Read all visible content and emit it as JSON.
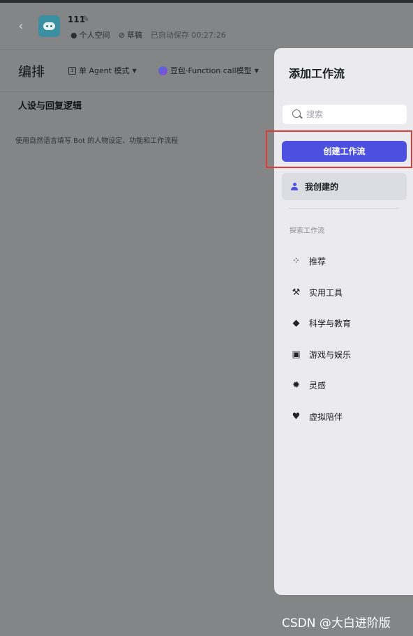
{
  "header": {
    "bot_name": "111",
    "space": "个人空间",
    "status": "草稿",
    "autosave": "已自动保存 00:27:26"
  },
  "toolbar": {
    "title": "编排",
    "mode": "单 Agent 模式",
    "model": "豆包·Function call模型"
  },
  "prompt": {
    "section_title": "人设与回复逻辑",
    "hint": "使用自然语言填写 Bot 的人物设定、功能和工作流程"
  },
  "panel": {
    "title": "添加工作流",
    "search_placeholder": "搜索",
    "create_button": "创建工作流",
    "mine_label": "我创建的",
    "explore_label": "探索工作流",
    "categories": [
      {
        "label": "推荐",
        "icon": "grid-dots-icon"
      },
      {
        "label": "实用工具",
        "icon": "wrench-icon"
      },
      {
        "label": "科学与教育",
        "icon": "graduation-cap-icon"
      },
      {
        "label": "游戏与娱乐",
        "icon": "gamepad-icon"
      },
      {
        "label": "灵感",
        "icon": "lightbulb-icon"
      },
      {
        "label": "虚拟陪伴",
        "icon": "heart-chat-icon"
      }
    ]
  },
  "watermark": "CSDN @大白进阶版",
  "colors": {
    "accent": "#4c4fe0",
    "highlight": "#e53935",
    "overlay": "#848587"
  }
}
